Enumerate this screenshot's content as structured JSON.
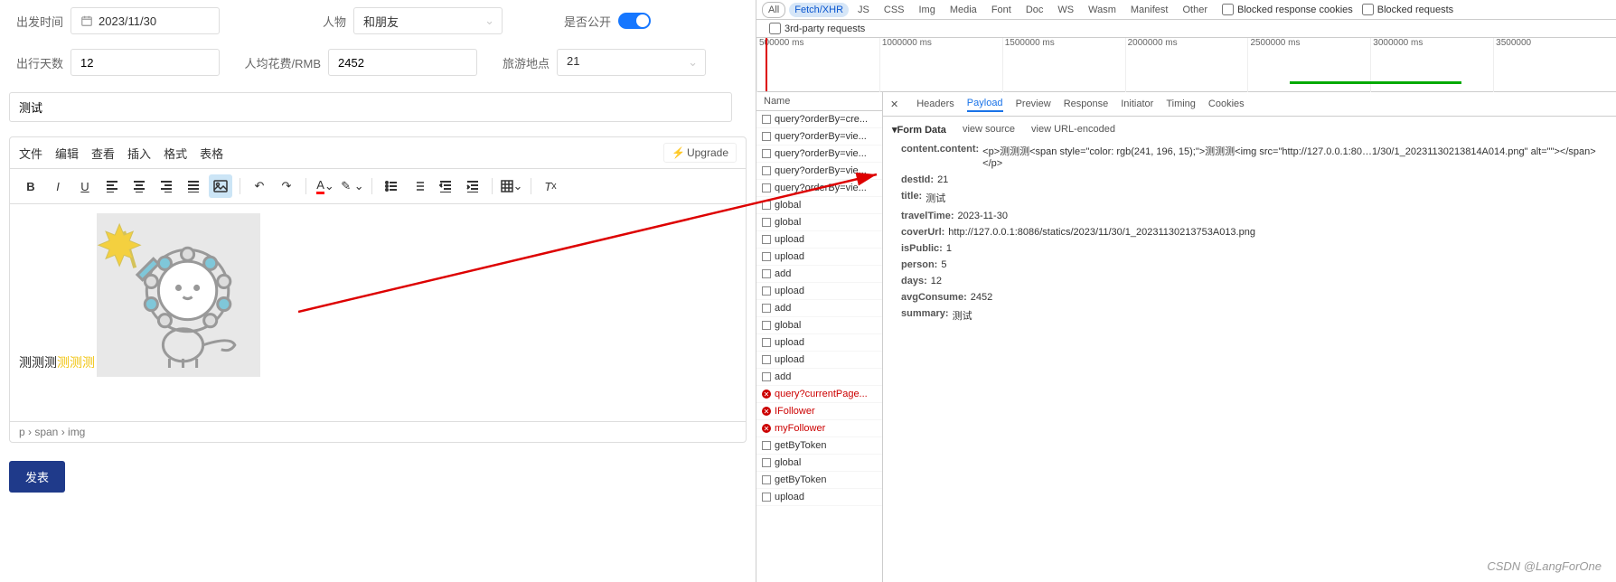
{
  "form": {
    "departure_label": "出发时间",
    "departure_value": "2023/11/30",
    "person_label": "人物",
    "person_value": "和朋友",
    "public_label": "是否公开",
    "days_label": "出行天数",
    "days_value": "12",
    "cost_label": "人均花费/RMB",
    "cost_value": "2452",
    "dest_label": "旅游地点",
    "dest_value": "21",
    "summary_value": "测试"
  },
  "editor": {
    "menu": {
      "file": "文件",
      "edit": "编辑",
      "view": "查看",
      "insert": "插入",
      "format": "格式",
      "table": "表格"
    },
    "upgrade_icon": "⚡",
    "upgrade_label": "Upgrade",
    "content_text_black": "测测测",
    "content_text_orange": "测测测",
    "path": "p › span › img"
  },
  "publish_label": "发表",
  "devtools": {
    "filters": [
      "All",
      "Fetch/XHR",
      "JS",
      "CSS",
      "Img",
      "Media",
      "Font",
      "Doc",
      "WS",
      "Wasm",
      "Manifest",
      "Other"
    ],
    "active_filter": "Fetch/XHR",
    "blocked_cookies_label": "Blocked response cookies",
    "blocked_requests_label": "Blocked requests",
    "third_party_label": "3rd-party requests",
    "timeline_ticks": [
      "500000 ms",
      "1000000 ms",
      "1500000 ms",
      "2000000 ms",
      "2500000 ms",
      "3000000 ms",
      "3500000"
    ],
    "name_header": "Name",
    "requests": [
      {
        "label": "query?orderBy=cre...",
        "error": false
      },
      {
        "label": "query?orderBy=vie...",
        "error": false
      },
      {
        "label": "query?orderBy=vie...",
        "error": false
      },
      {
        "label": "query?orderBy=vie...",
        "error": false
      },
      {
        "label": "query?orderBy=vie...",
        "error": false
      },
      {
        "label": "global",
        "error": false
      },
      {
        "label": "global",
        "error": false
      },
      {
        "label": "upload",
        "error": false
      },
      {
        "label": "upload",
        "error": false
      },
      {
        "label": "add",
        "error": false
      },
      {
        "label": "upload",
        "error": false
      },
      {
        "label": "add",
        "error": false
      },
      {
        "label": "global",
        "error": false
      },
      {
        "label": "upload",
        "error": false
      },
      {
        "label": "upload",
        "error": false
      },
      {
        "label": "add",
        "error": false
      },
      {
        "label": "query?currentPage...",
        "error": true
      },
      {
        "label": "IFollower",
        "error": true
      },
      {
        "label": "myFollower",
        "error": true
      },
      {
        "label": "getByToken",
        "error": false
      },
      {
        "label": "global",
        "error": false
      },
      {
        "label": "getByToken",
        "error": false
      },
      {
        "label": "upload",
        "error": false
      }
    ],
    "detail_tabs": [
      "Headers",
      "Payload",
      "Preview",
      "Response",
      "Initiator",
      "Timing",
      "Cookies"
    ],
    "active_detail_tab": "Payload",
    "form_data_label": "Form Data",
    "view_source_label": "view source",
    "view_url_encoded_label": "view URL-encoded",
    "payload": [
      {
        "key": "content.content:",
        "val": "<p>测测测<span style=\"color: rgb(241, 196, 15);\">测测测<img src=\"http://127.0.0.1:80…1/30/1_20231130213814A014.png\" alt=\"\"></span></p>"
      },
      {
        "key": "destId:",
        "val": "21"
      },
      {
        "key": "title:",
        "val": "测试"
      },
      {
        "key": "travelTime:",
        "val": "2023-11-30"
      },
      {
        "key": "coverUrl:",
        "val": "http://127.0.0.1:8086/statics/2023/11/30/1_20231130213753A013.png"
      },
      {
        "key": "isPublic:",
        "val": "1"
      },
      {
        "key": "person:",
        "val": "5"
      },
      {
        "key": "days:",
        "val": "12"
      },
      {
        "key": "avgConsume:",
        "val": "2452"
      },
      {
        "key": "summary:",
        "val": "测试"
      }
    ]
  },
  "watermark": "CSDN @LangForOne"
}
